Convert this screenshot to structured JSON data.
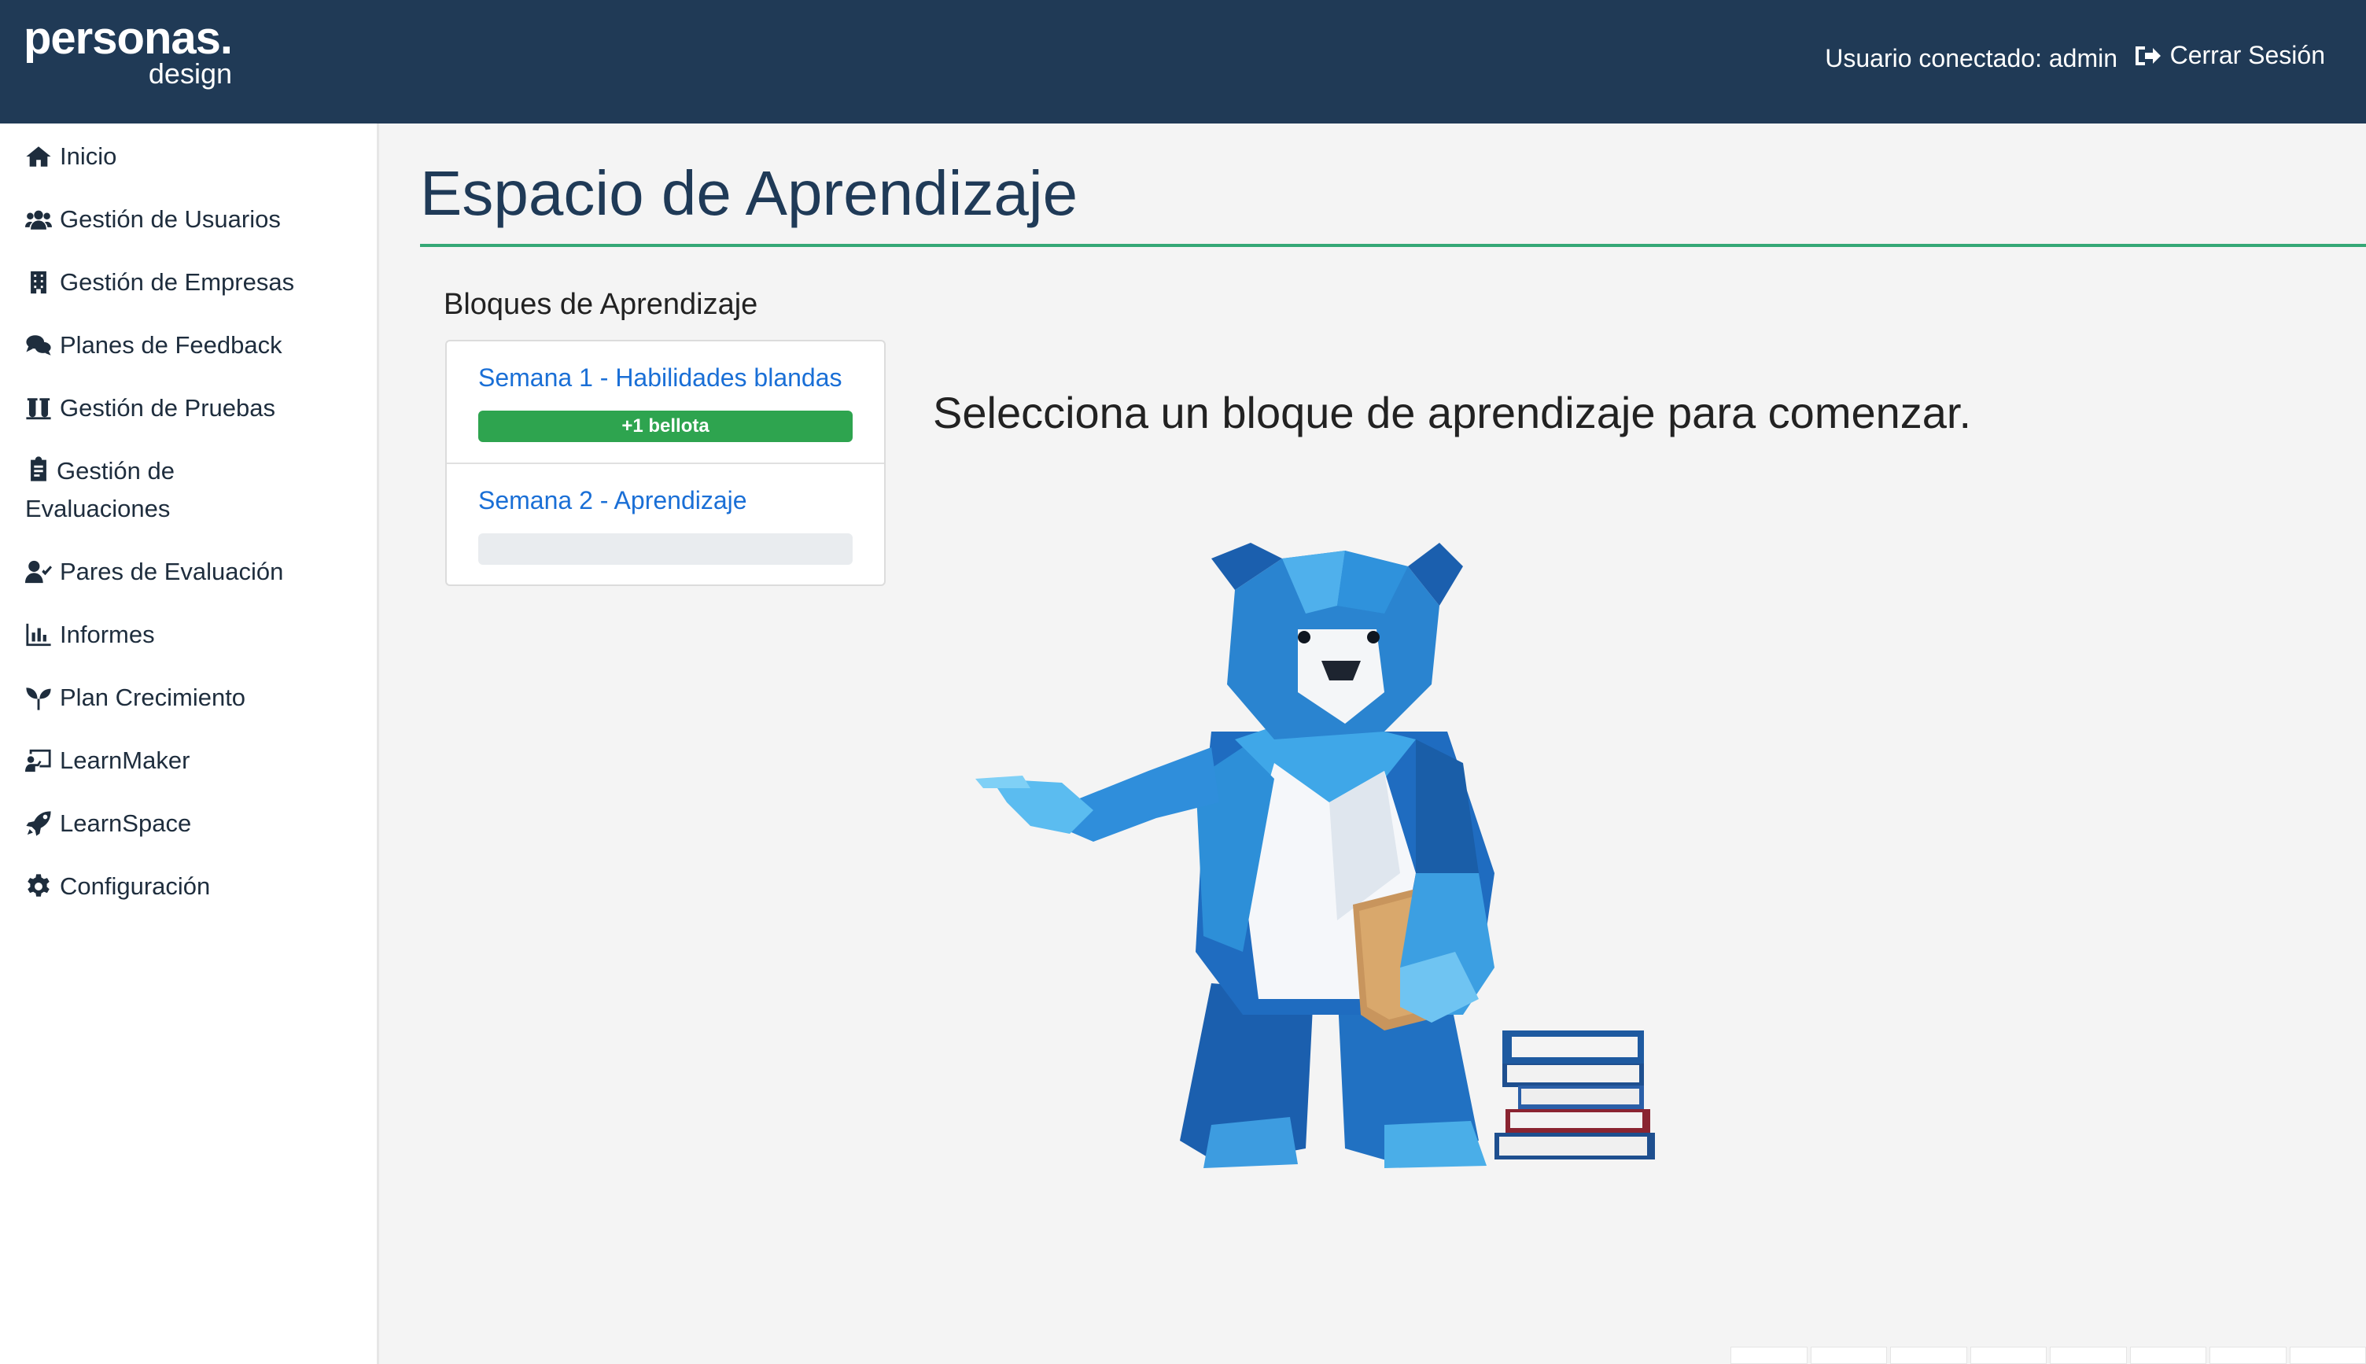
{
  "header": {
    "logo_main": "personas.",
    "logo_sub": "design",
    "user_label": "Usuario conectado: admin",
    "logout_label": "Cerrar Sesión"
  },
  "sidebar": {
    "items": [
      {
        "label": "Inicio",
        "icon": "home-icon"
      },
      {
        "label": "Gestión de Usuarios",
        "icon": "users-icon"
      },
      {
        "label": "Gestión de Empresas",
        "icon": "building-icon"
      },
      {
        "label": "Planes de Feedback",
        "icon": "comments-icon"
      },
      {
        "label": "Gestión de Pruebas",
        "icon": "vials-icon"
      },
      {
        "label": "Gestión de Evaluaciones",
        "icon": "clipboard-icon"
      },
      {
        "label": "Pares de Evaluación",
        "icon": "user-check-icon"
      },
      {
        "label": "Informes",
        "icon": "chart-icon"
      },
      {
        "label": "Plan Crecimiento",
        "icon": "seedling-icon"
      },
      {
        "label": "LearnMaker",
        "icon": "chalkboard-icon"
      },
      {
        "label": "LearnSpace",
        "icon": "rocket-icon"
      },
      {
        "label": "Configuración",
        "icon": "gear-icon"
      }
    ]
  },
  "main": {
    "title": "Espacio de Aprendizaje",
    "blocks_heading": "Bloques de Aprendizaje",
    "blocks": [
      {
        "title": "Semana 1 - Habilidades blandas",
        "progress_label": "+1 bellota",
        "progress": 1.0
      },
      {
        "title": "Semana 2 - Aprendizaje",
        "progress_label": "",
        "progress": 0.0
      }
    ],
    "prompt": "Selecciona un bloque de aprendizaje para comenzar.",
    "illustration": "origami-bear-teacher-icon"
  },
  "colors": {
    "header_bg": "#203a56",
    "accent_green": "#35a876",
    "progress_green": "#2ea44f",
    "link_blue": "#1a6fd6"
  }
}
